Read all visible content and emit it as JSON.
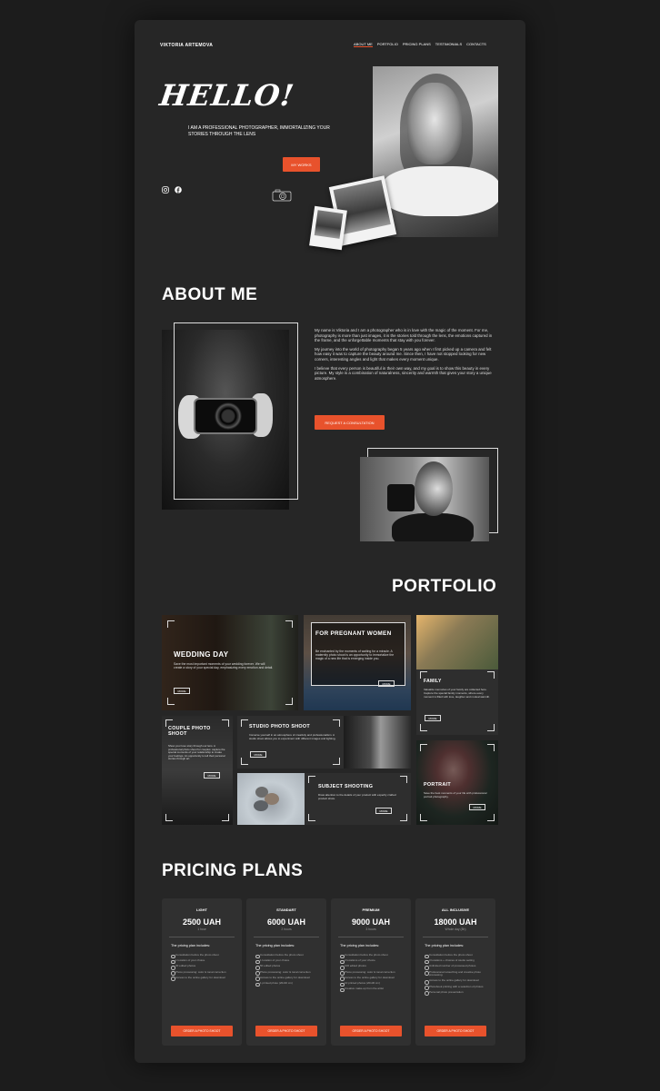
{
  "header": {
    "logo": "VIKTORIA ARTEMOVA",
    "nav": [
      "ABOUT ME",
      "PORTFOLIO",
      "PRICING PLANS",
      "TESTIMONIALS",
      "CONTACTS"
    ]
  },
  "hero": {
    "title": "HELLO!",
    "subtitle": "I AM A PROFESSIONAL PHOTOGRAPHER, IMMORTALIZING YOUR STORIES THROUGH THE LENS",
    "button": "MY WORKS"
  },
  "about": {
    "title": "ABOUT ME",
    "paragraphs": [
      "My name is Viktoria and I am a photographer who is in love with the magic of the moment. For me, photography is more than just images, it is the stories told through the lens, the emotions captured in the frame, and the unforgettable moments that stay with you forever.",
      "My journey into the world of photography began 5 years ago when I first picked up a camera and felt how easy it was to capture the beauty around me. Since then, I have not stopped looking for new corners, interesting angles and light that makes every moment unique.",
      "I believe that every person is beautiful in their own way, and my goal is to show this beauty in every picture. My style is a combination of naturalness, sincerity and warmth that gives your story a unique atmosphere."
    ],
    "button": "REQUEST A CONSULTATION"
  },
  "portfolio": {
    "title": "PORTFOLIO",
    "more": "MORE",
    "wedding": {
      "title": "WEDDING DAY",
      "text": "Save the most important moments of your wedding forever. We will create a story of your special day, emphasizing every emotion and detail."
    },
    "pregnant": {
      "title": "FOR PREGNANT WOMEN",
      "text": "Be enchanted by the moments of waiting for a miracle. A maternity photo shoot is an opportunity to immortalize the magic of a new life that is emerging inside you."
    },
    "family": {
      "title": "FAMILY",
      "text": "Valuable memories of your family are collected here. Capture the special family moments, where every moment is filled with love, laughter and mutual warmth."
    },
    "couple": {
      "title": "COUPLE PHOTO SHOOT",
      "text": "Show your love story through our lens. A professional photo shoot for couples: capture the special moments of your relationship to create your feelings. An opportunity to tell their personal stories through art."
    },
    "studio": {
      "title": "STUDIO PHOTO SHOOT",
      "text": "Immerse yourself in an atmosphere of creativity and professionalism. A studio shoot allows you to experiment with different images and lighting."
    },
    "subject": {
      "title": "SUBJECT SHOOTING",
      "text": "Draw attention to the details of your product with expertly crafted product shots."
    },
    "portrait": {
      "title": "PORTRAIT",
      "text": "Save the best moments of your life with professional portrait photography."
    }
  },
  "pricing": {
    "title": "PRICING PLANS",
    "includes_label": "The pricing plan includes:",
    "order_label": "ORDER A PHOTO SHOOT",
    "plans": [
      {
        "name": "LIGHT",
        "price": "2500 UAH",
        "duration": "1 hour",
        "features": [
          "Consultation before the photo shoot",
          "1 location of your choice",
          "30 edited photos",
          "Photo processing: color & tonal correction",
          "Access to the online gallery for download"
        ]
      },
      {
        "name": "STANDART",
        "price": "6000 UAH",
        "duration": "2 hours",
        "features": [
          "Consultation before the photo shoot",
          "1 location of your choice",
          "50 edited photos",
          "Photo processing: color & tonal correction",
          "Access to the online gallery for download",
          "1 printed photo (20x30 cm)"
        ]
      },
      {
        "name": "PREMIUM",
        "price": "9000 UAH",
        "duration": "3 hours",
        "features": [
          "Consultation before the photo shoot",
          "2 locations of your choice",
          "100 edited photos",
          "Photo processing: color & tonal correction",
          "Access to the online gallery for download",
          "10 printed photos (20x30 cm)",
          "Creative make-up from the artist"
        ]
      },
      {
        "name": "ALL INCLUSIVE",
        "price": "18000 UAH",
        "duration": "Whole day (8h)",
        "features": [
          "Consultation before the photo shoot",
          "3 locations + choices of studio setting",
          "Unlimited number of processed photos",
          "Professional retouching and creative photo processing",
          "Access to the online gallery for download",
          "Photobook printing with a selection of photos",
          "Personal photo presentation"
        ]
      }
    ]
  },
  "colors": {
    "accent": "#e8522c",
    "background": "#1c1c1c",
    "panel": "#262626"
  }
}
